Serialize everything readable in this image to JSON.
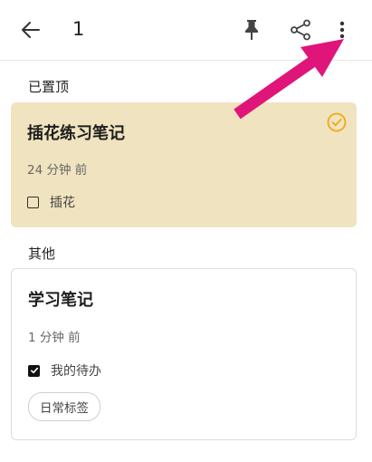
{
  "header": {
    "back_icon": "arrow-left-icon",
    "selected_count": "1",
    "pin_icon": "pin-icon",
    "share_icon": "share-icon",
    "more_icon": "more-vertical-icon"
  },
  "sections": {
    "pinned_label": "已置顶",
    "other_label": "其他"
  },
  "pinned_note": {
    "title": "插花练习笔记",
    "time": "24 分钟 前",
    "todo_label": "插花",
    "todo_checked": false,
    "selected": true,
    "background": "#f0e3bf",
    "check_color": "#f3a714"
  },
  "other_note": {
    "title": "学习笔记",
    "time": "1 分钟 前",
    "todo_label": "我的待办",
    "todo_checked": true,
    "tag": "日常标签"
  },
  "annotation": {
    "arrow_color": "#e0157a"
  }
}
